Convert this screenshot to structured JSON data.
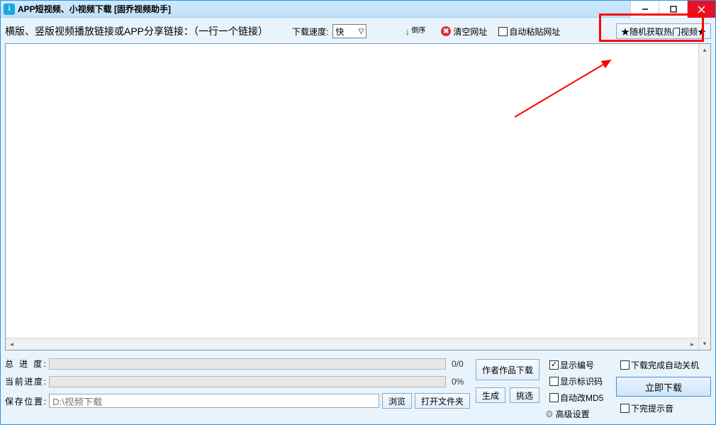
{
  "titlebar": {
    "app_icon_letter": "i",
    "title": "APP短视频、小视频下载 [固乔视频助手]"
  },
  "toolbar": {
    "link_label": "横版、竖版视频播放链接或APP分享链接：（一行一个链接）",
    "speed_label": "下载速度:",
    "speed_value": "快",
    "reverse_label": "倒序",
    "clear_label": "清空网址",
    "auto_paste_label": "自动粘贴网址",
    "random_hot_label": "★随机获取热门视频★"
  },
  "textarea": {
    "value": ""
  },
  "bottom": {
    "progress_total_label": "总 进 度:",
    "progress_total_value": "0/0",
    "progress_current_label": "当前进度:",
    "progress_current_value": "0%",
    "save_path_label": "保存位置:",
    "save_path_value": "D:\\视频下载",
    "browse_label": "浏览",
    "open_folder_label": "打开文件夹",
    "author_works_label": "作者作品下载",
    "generate_label": "生成",
    "pick_label": "挑选",
    "show_number_label": "显示编号",
    "show_id_label": "显示标识码",
    "auto_md5_label": "自动改MD5",
    "advanced_label": "高级设置",
    "auto_shutdown_label": "下载完成自动关机",
    "download_now_label": "立即下载",
    "mute_label": "下完提示音"
  }
}
